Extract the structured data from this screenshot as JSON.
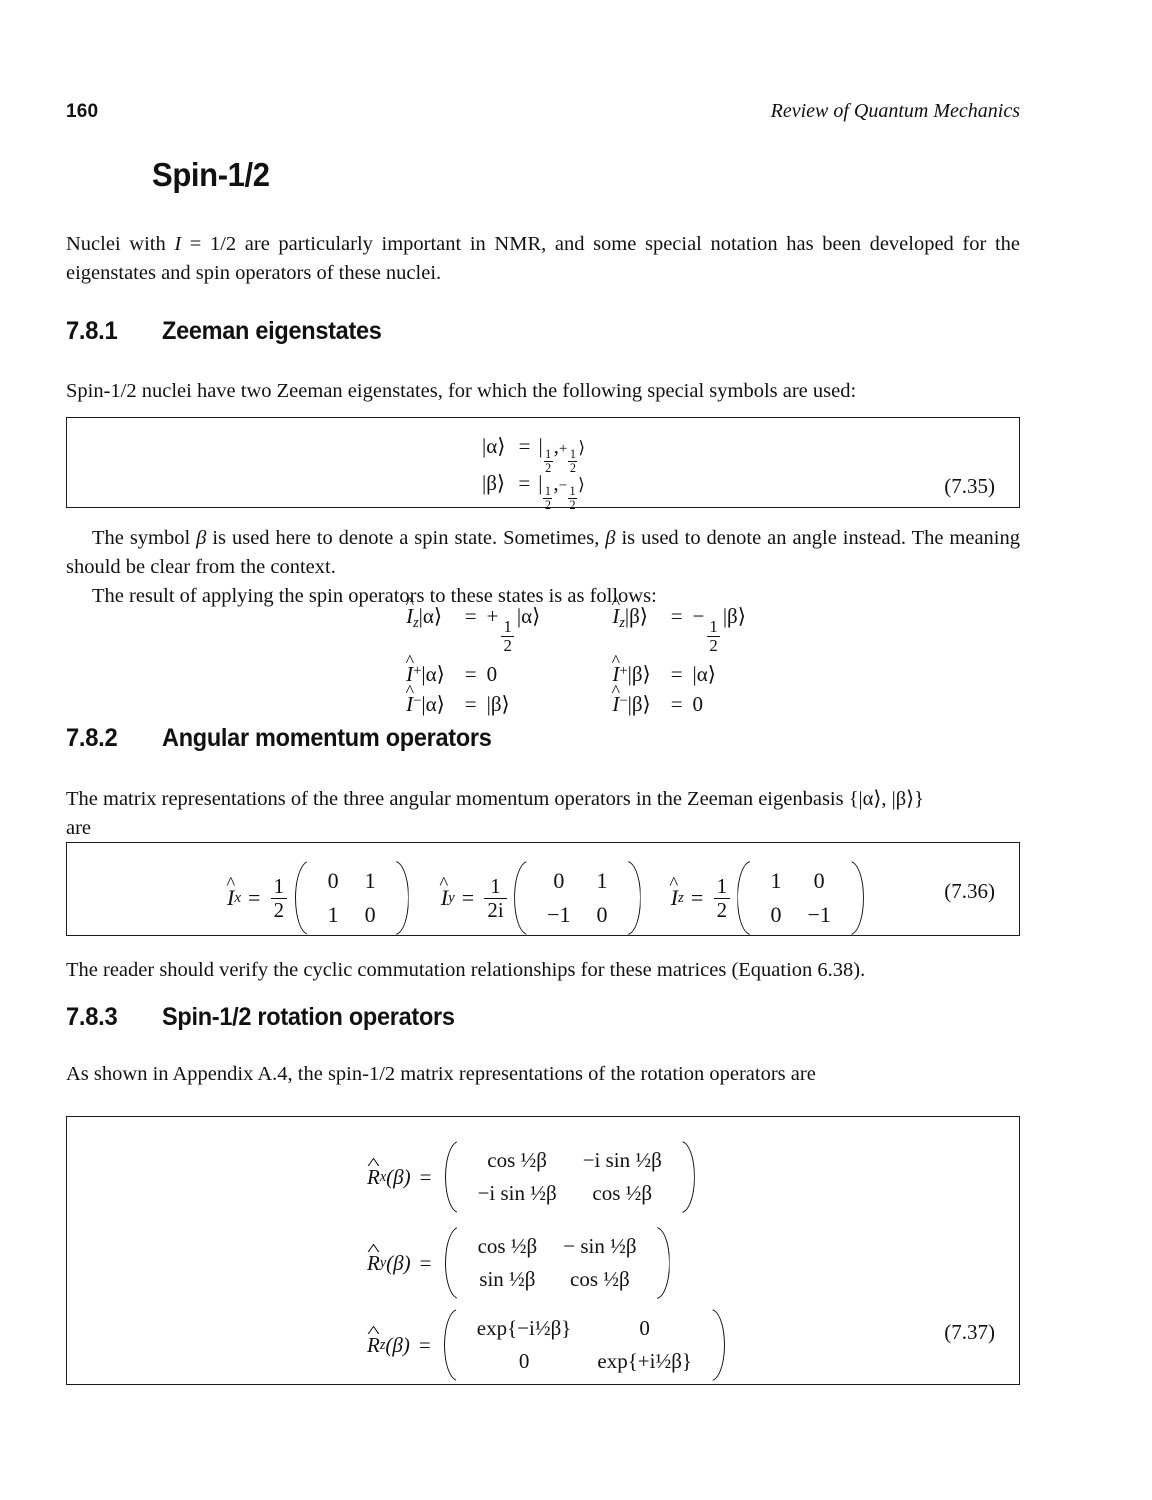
{
  "header": {
    "folio": "160",
    "running_title": "Review of Quantum Mechanics"
  },
  "chapter_title": "Spin-1/2",
  "intro_paragraph": "Nuclei with I = 1/2 are particularly important in NMR, and some special notation has been developed for the eigenstates and spin operators of these nuclei.",
  "intro_paragraph_parts": {
    "before": "Nuclei with ",
    "symbol": "I",
    "after": " = 1/2 are particularly important in NMR, and some special notation has been developed for the eigenstates and spin operators of these nuclei."
  },
  "sections": [
    {
      "number": "7.8.1",
      "title": "Zeeman eigenstates",
      "lead_paragraph": "Spin-1/2 nuclei have two Zeeman eigenstates, for which the following special symbols are used:"
    },
    {
      "number": "7.8.2",
      "title": "Angular momentum operators",
      "lead_paragraph_a": "The matrix representations of the three angular momentum operators in the Zeeman eigenbasis {|α⟩, |β⟩}",
      "lead_paragraph_b": "are"
    },
    {
      "number": "7.8.3",
      "title": "Spin-1/2 rotation operators",
      "lead_paragraph": "As shown in Appendix A.4, the spin-1/2 matrix representations of the rotation operators are"
    }
  ],
  "equation_735": {
    "number": "(7.35)",
    "lines": [
      {
        "lhs_ket": "|α⟩",
        "eq": "=",
        "rhs_prefix": "|",
        "rhs_first": "1/2",
        "rhs_sep": ",",
        "rhs_sign": "+",
        "rhs_second": "1/2",
        "rhs_suffix": "⟩"
      },
      {
        "lhs_ket": "|β⟩",
        "eq": "=",
        "rhs_prefix": "|",
        "rhs_first": "1/2",
        "rhs_sep": ",",
        "rhs_sign": "−",
        "rhs_second": "1/2",
        "rhs_suffix": "⟩"
      }
    ]
  },
  "beta_note_paragraph": "The symbol β is used here to denote a spin state. Sometimes, β is used to denote an angle instead. The meaning should be clear from the context.",
  "operator_intro_paragraph": "The result of applying the spin operators to these states is as follows:",
  "operator_actions": {
    "left_column": [
      {
        "operator": "I",
        "op_sub": "z",
        "op_sup": "",
        "ket": "|α⟩",
        "eq": "=",
        "result_sign": "+",
        "result_frac": "1/2",
        "result_ket": "|α⟩"
      },
      {
        "operator": "I",
        "op_sub": "",
        "op_sup": "+",
        "ket": "|α⟩",
        "eq": "=",
        "result_sign": "",
        "result_frac": "",
        "result_ket": "0"
      },
      {
        "operator": "I",
        "op_sub": "",
        "op_sup": "−",
        "ket": "|α⟩",
        "eq": "=",
        "result_sign": "",
        "result_frac": "",
        "result_ket": "|β⟩"
      }
    ],
    "right_column": [
      {
        "operator": "I",
        "op_sub": "z",
        "op_sup": "",
        "ket": "|β⟩",
        "eq": "=",
        "result_sign": "−",
        "result_frac": "1/2",
        "result_ket": "|β⟩"
      },
      {
        "operator": "I",
        "op_sub": "",
        "op_sup": "+",
        "ket": "|β⟩",
        "eq": "=",
        "result_sign": "",
        "result_frac": "",
        "result_ket": "|α⟩"
      },
      {
        "operator": "I",
        "op_sub": "",
        "op_sup": "−",
        "ket": "|β⟩",
        "eq": "=",
        "result_sign": "",
        "result_frac": "",
        "result_ket": "0"
      }
    ]
  },
  "equation_736": {
    "number": "(7.36)",
    "operators": [
      {
        "symbol": "I",
        "subscript": "x",
        "prefactor_num": "1",
        "prefactor_den": "2",
        "matrix": [
          [
            "0",
            "1"
          ],
          [
            "1",
            "0"
          ]
        ]
      },
      {
        "symbol": "I",
        "subscript": "y",
        "prefactor_num": "1",
        "prefactor_den": "2i",
        "matrix": [
          [
            "0",
            "1"
          ],
          [
            "−1",
            "0"
          ]
        ]
      },
      {
        "symbol": "I",
        "subscript": "z",
        "prefactor_num": "1",
        "prefactor_den": "2",
        "matrix": [
          [
            "1",
            "0"
          ],
          [
            "0",
            "−1"
          ]
        ]
      }
    ]
  },
  "commutation_paragraph": "The reader should verify the cyclic commutation relationships for these matrices (Equation 6.38).",
  "equation_737": {
    "number": "(7.37)",
    "rotations": [
      {
        "symbol": "R",
        "subscript": "x",
        "argument": "(β)",
        "matrix": [
          [
            "cos ½β",
            "−i sin ½β"
          ],
          [
            "−i sin ½β",
            "cos ½β"
          ]
        ]
      },
      {
        "symbol": "R",
        "subscript": "y",
        "argument": "(β)",
        "matrix": [
          [
            "cos ½β",
            "− sin ½β"
          ],
          [
            "sin ½β",
            "cos ½β"
          ]
        ]
      },
      {
        "symbol": "R",
        "subscript": "z",
        "argument": "(β)",
        "matrix": [
          [
            "exp{−i½β}",
            "0"
          ],
          [
            "0",
            "exp{+i½β}"
          ]
        ]
      }
    ]
  }
}
